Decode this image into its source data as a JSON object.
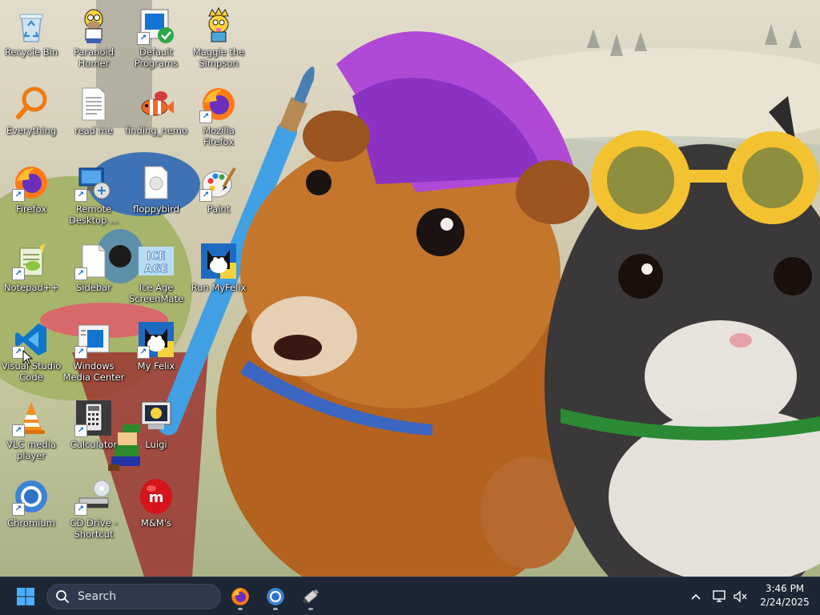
{
  "desktop": {
    "icons": [
      {
        "id": "recycle-bin",
        "label": "Recycle Bin",
        "icon": "recycle-bin-icon",
        "shortcut": false
      },
      {
        "id": "everything",
        "label": "Everything",
        "icon": "magnifier-icon",
        "shortcut": false
      },
      {
        "id": "firefox",
        "label": "Firefox",
        "icon": "firefox-icon",
        "shortcut": true
      },
      {
        "id": "notepadpp",
        "label": "Notepad++",
        "icon": "notepadpp-icon",
        "shortcut": true
      },
      {
        "id": "vscode",
        "label": "Visual Studio Code",
        "icon": "vscode-icon",
        "shortcut": true
      },
      {
        "id": "vlc",
        "label": "VLC media player",
        "icon": "vlc-cone-icon",
        "shortcut": true
      },
      {
        "id": "chromium",
        "label": "Chromium",
        "icon": "chromium-icon",
        "shortcut": true
      },
      {
        "id": "paranoid-homer",
        "label": "Paranoid Homer",
        "icon": "homer-icon",
        "shortcut": false
      },
      {
        "id": "read-me",
        "label": "read me",
        "icon": "text-document-icon",
        "shortcut": false
      },
      {
        "id": "remote-desktop",
        "label": "Remote Desktop ...",
        "icon": "remote-desktop-icon",
        "shortcut": true
      },
      {
        "id": "sidebar",
        "label": "Sidebar",
        "icon": "blank-document-icon",
        "shortcut": true
      },
      {
        "id": "wmc",
        "label": "Windows Media Center",
        "icon": "media-center-icon",
        "shortcut": true
      },
      {
        "id": "calculator",
        "label": "Calculator",
        "icon": "calculator-icon",
        "shortcut": true
      },
      {
        "id": "cd-drive",
        "label": "CD Drive - Shortcut",
        "icon": "cd-drive-icon",
        "shortcut": true
      },
      {
        "id": "default-programs",
        "label": "Default Programs",
        "icon": "default-programs-icon",
        "shortcut": true
      },
      {
        "id": "finding-nemo",
        "label": "finding_nemo",
        "icon": "fish-icon",
        "shortcut": false
      },
      {
        "id": "floppybird",
        "label": "floppybird",
        "icon": "file-icon",
        "shortcut": false
      },
      {
        "id": "ice-age",
        "label": "Ice Age ScreenMate",
        "icon": "ice-age-icon",
        "shortcut": false
      },
      {
        "id": "my-felix",
        "label": "My Felix",
        "icon": "felix-cat-icon",
        "shortcut": true
      },
      {
        "id": "luigi",
        "label": "Luigi",
        "icon": "luigi-computer-icon",
        "shortcut": false
      },
      {
        "id": "mms",
        "label": "M&M's",
        "icon": "mms-candy-icon",
        "shortcut": false
      },
      {
        "id": "maggie",
        "label": "Maggie the Simpson",
        "icon": "maggie-icon",
        "shortcut": false
      },
      {
        "id": "mozilla-firefox",
        "label": "Mozilla Firefox",
        "icon": "firefox-icon",
        "shortcut": true
      },
      {
        "id": "paint",
        "label": "Paint",
        "icon": "paint-palette-icon",
        "shortcut": true
      },
      {
        "id": "run-myfelix",
        "label": "Run MyFelix",
        "icon": "felix-cat-icon",
        "shortcut": false
      }
    ]
  },
  "taskbar": {
    "search_placeholder": "Search",
    "pinned": [
      {
        "id": "firefox",
        "icon": "firefox-icon"
      },
      {
        "id": "chromium",
        "icon": "chromium-icon"
      },
      {
        "id": "usb-tool",
        "icon": "usb-drive-icon"
      }
    ],
    "clock": {
      "time": "3:46 PM",
      "date": "2/24/2025"
    }
  },
  "colors": {
    "taskbar_bg": "#1c2634",
    "accent": "#0078d4",
    "firefox_orange": "#ff7a18"
  }
}
